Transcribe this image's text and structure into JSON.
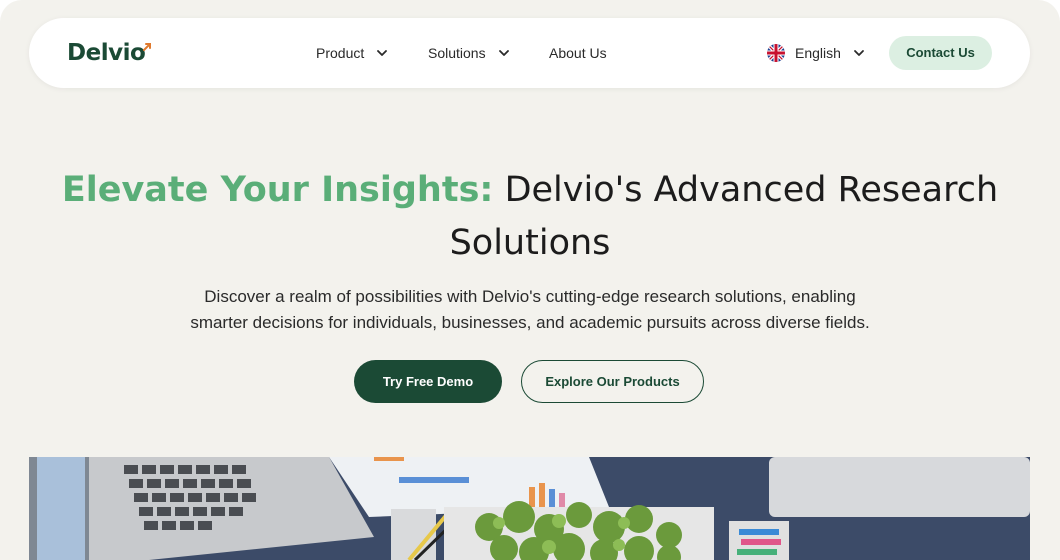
{
  "brand": {
    "name": "Delvio",
    "accent": "#e07a2f",
    "primary": "#1b4a35",
    "highlight": "#5aae78"
  },
  "nav": {
    "items": [
      {
        "label": "Product",
        "has_dropdown": true
      },
      {
        "label": "Solutions",
        "has_dropdown": true
      },
      {
        "label": "About Us",
        "has_dropdown": false
      }
    ],
    "language": {
      "label": "English",
      "flag": "uk-flag-icon"
    },
    "contact_label": "Contact Us"
  },
  "hero": {
    "title_accent": "Elevate Your Insights:",
    "title_rest_line1": "Delvio's Advanced Research",
    "title_rest_line2": "Solutions",
    "subtitle_line1": "Discover a realm of possibilities with Delvio's cutting-edge research solutions, enabling",
    "subtitle_line2": "smarter decisions for individuals, businesses, and academic pursuits across diverse fields.",
    "primary_cta": "Try Free Demo",
    "secondary_cta": "Explore Our Products"
  }
}
